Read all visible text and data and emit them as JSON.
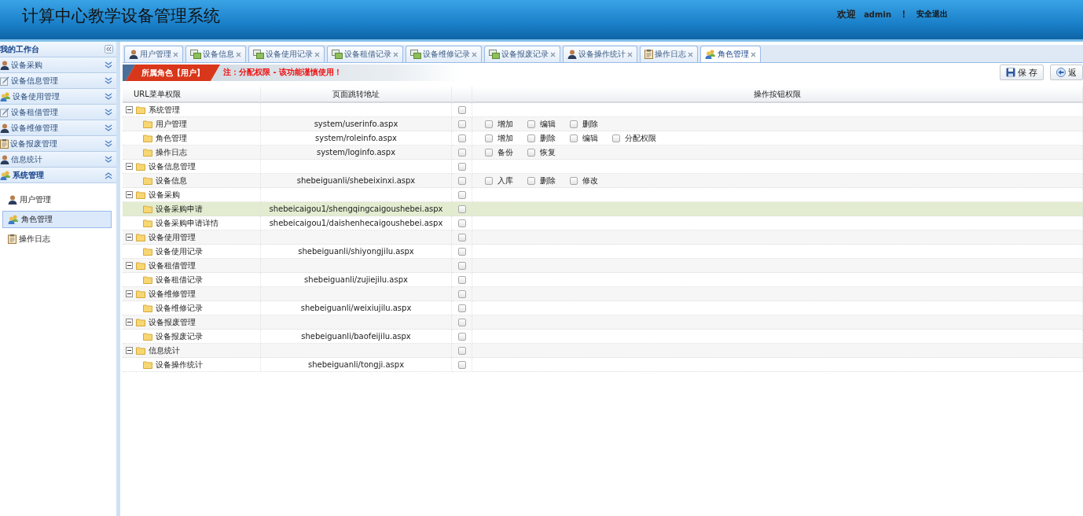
{
  "header": {
    "title": "计算中心教学设备管理系统",
    "welcome": "欢迎",
    "user": "admin",
    "exclaim": "！",
    "logout": "安全退出"
  },
  "sidebar": {
    "title": "我的工作台",
    "groups": [
      {
        "label": "设备采购",
        "kind": "user",
        "expanded": false
      },
      {
        "label": "设备信息管理",
        "kind": "pen",
        "expanded": false
      },
      {
        "label": "设备使用管理",
        "kind": "group",
        "expanded": false
      },
      {
        "label": "设备租借管理",
        "kind": "pen",
        "expanded": false
      },
      {
        "label": "设备维修管理",
        "kind": "user",
        "expanded": false
      },
      {
        "label": "设备报废管理",
        "kind": "clipboard",
        "expanded": false
      },
      {
        "label": "信息统计",
        "kind": "user",
        "expanded": false
      },
      {
        "label": "系统管理",
        "kind": "group",
        "expanded": true
      }
    ],
    "items": [
      {
        "label": "用户管理",
        "kind": "user",
        "selected": false
      },
      {
        "label": "角色管理",
        "kind": "group",
        "selected": true
      },
      {
        "label": "操作日志",
        "kind": "clipboard",
        "selected": false
      }
    ]
  },
  "tabs": [
    {
      "label": "用户管理",
      "kind": "user",
      "selected": false
    },
    {
      "label": "设备信息",
      "kind": "window",
      "selected": false
    },
    {
      "label": "设备使用记录",
      "kind": "window",
      "selected": false
    },
    {
      "label": "设备租借记录",
      "kind": "window",
      "selected": false
    },
    {
      "label": "设备维修记录",
      "kind": "window",
      "selected": false
    },
    {
      "label": "设备报废记录",
      "kind": "window",
      "selected": false
    },
    {
      "label": "设备操作统计",
      "kind": "user",
      "selected": false
    },
    {
      "label": "操作日志",
      "kind": "clipboard",
      "selected": false
    },
    {
      "label": "角色管理",
      "kind": "group",
      "selected": true
    }
  ],
  "banner": {
    "role": "所属角色【用户】",
    "note": "注：分配权限 - 该功能谨慎使用！"
  },
  "buttons": [
    {
      "label": "保 存",
      "kind": "save"
    },
    {
      "label": "返",
      "kind": "back"
    }
  ],
  "table": {
    "columns": [
      "URL菜单权限",
      "页面跳转地址",
      "操作按钮权限"
    ],
    "rows": [
      {
        "label": "系统管理",
        "checked": false,
        "expanded": true,
        "selected": false,
        "children": [
          {
            "label": "用户管理",
            "url": "system/userinfo.aspx",
            "checked": false,
            "selected": false,
            "actions": [
              {
                "label": "增加",
                "checked": false
              },
              {
                "label": "编辑",
                "checked": false
              },
              {
                "label": "删除",
                "checked": false
              }
            ]
          },
          {
            "label": "角色管理",
            "url": "system/roleinfo.aspx",
            "checked": false,
            "selected": false,
            "actions": [
              {
                "label": "增加",
                "checked": false
              },
              {
                "label": "删除",
                "checked": false
              },
              {
                "label": "编辑",
                "checked": false
              },
              {
                "label": "分配权限",
                "checked": false
              }
            ]
          },
          {
            "label": "操作日志",
            "url": "system/loginfo.aspx",
            "checked": false,
            "selected": false,
            "actions": [
              {
                "label": "备份",
                "checked": false
              },
              {
                "label": "恢复",
                "checked": false
              }
            ]
          }
        ]
      },
      {
        "label": "设备信息管理",
        "checked": false,
        "expanded": true,
        "selected": false,
        "children": [
          {
            "label": "设备信息",
            "url": "shebeiguanli/shebeixinxi.aspx",
            "checked": false,
            "selected": false,
            "actions": [
              {
                "label": "入库",
                "checked": false
              },
              {
                "label": "删除",
                "checked": false
              },
              {
                "label": "修改",
                "checked": false
              }
            ]
          }
        ]
      },
      {
        "label": "设备采购",
        "checked": false,
        "expanded": true,
        "selected": false,
        "children": [
          {
            "label": "设备采购申请",
            "url": "shebeicaigou1/shengqingcaigoushebei.aspx",
            "checked": false,
            "selected": true
          },
          {
            "label": "设备采购申请详情",
            "url": "shebeicaigou1/daishenhecaigoushebei.aspx",
            "checked": false,
            "selected": false
          }
        ]
      },
      {
        "label": "设备使用管理",
        "checked": false,
        "expanded": true,
        "selected": false,
        "children": [
          {
            "label": "设备使用记录",
            "url": "shebeiguanli/shiyongjilu.aspx",
            "checked": false,
            "selected": false
          }
        ]
      },
      {
        "label": "设备租借管理",
        "checked": false,
        "expanded": true,
        "selected": false,
        "children": [
          {
            "label": "设备租借记录",
            "url": "shebeiguanli/zujiejilu.aspx",
            "checked": false,
            "selected": false
          }
        ]
      },
      {
        "label": "设备维修管理",
        "checked": false,
        "expanded": true,
        "selected": false,
        "children": [
          {
            "label": "设备维修记录",
            "url": "shebeiguanli/weixiujilu.aspx",
            "checked": false,
            "selected": false
          }
        ]
      },
      {
        "label": "设备报废管理",
        "checked": false,
        "expanded": true,
        "selected": false,
        "children": [
          {
            "label": "设备报废记录",
            "url": "shebeiguanli/baofeijilu.aspx",
            "checked": false,
            "selected": false
          }
        ]
      },
      {
        "label": "信息统计",
        "checked": false,
        "expanded": true,
        "selected": false,
        "children": [
          {
            "label": "设备操作统计",
            "url": "shebeiguanli/tongji.aspx",
            "checked": false,
            "selected": false
          }
        ]
      }
    ]
  }
}
